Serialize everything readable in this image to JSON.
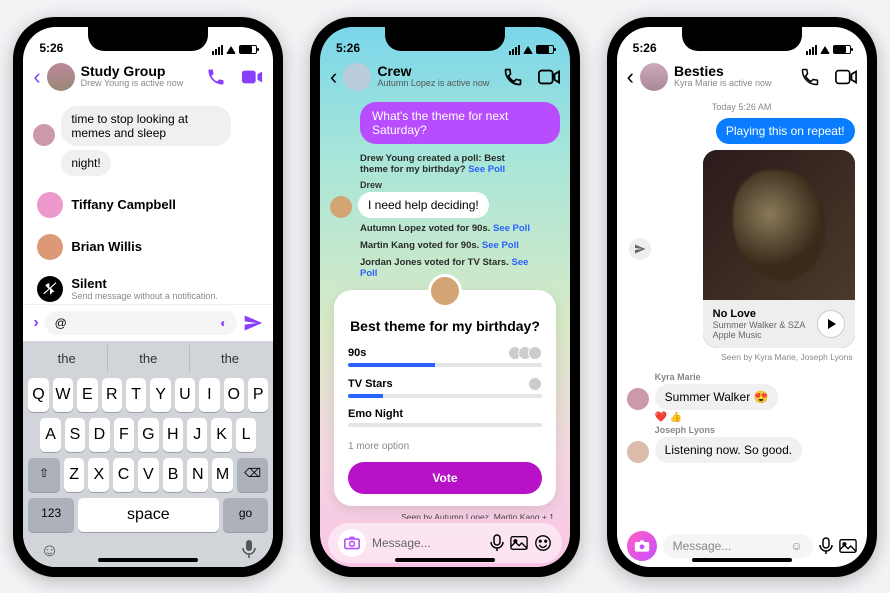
{
  "status": {
    "time": "5:26"
  },
  "phone1": {
    "header": {
      "title": "Study Group",
      "subtitle": "Drew Young is active now"
    },
    "messages": [
      {
        "text": "time to stop looking at memes and sleep"
      },
      {
        "text": "night!"
      }
    ],
    "mentions": [
      {
        "name": "Tiffany Campbell"
      },
      {
        "name": "Brian Willis"
      },
      {
        "name": "Silent",
        "desc": "Send message without a notification."
      }
    ],
    "compose": {
      "value": "@"
    },
    "suggestions": [
      "the",
      "the",
      "the"
    ],
    "keyboard": {
      "row1": [
        "Q",
        "W",
        "E",
        "R",
        "T",
        "Y",
        "U",
        "I",
        "O",
        "P"
      ],
      "row2": [
        "A",
        "S",
        "D",
        "F",
        "G",
        "H",
        "J",
        "K",
        "L"
      ],
      "row3": [
        "Z",
        "X",
        "C",
        "V",
        "B",
        "N",
        "M"
      ],
      "num": "123",
      "space": "space",
      "go": "go"
    }
  },
  "phone2": {
    "header": {
      "title": "Crew",
      "subtitle": "Autumn Lopez is active now"
    },
    "question": "What's the theme for next Saturday?",
    "events": [
      {
        "text": "Drew Young created a poll: Best theme for my birthday? ",
        "link": "See Poll"
      }
    ],
    "sender": "Drew",
    "msg": "I need help deciding!",
    "votes": [
      {
        "text": "Autumn Lopez voted for 90s. ",
        "link": "See Poll"
      },
      {
        "text": "Martin Kang voted for 90s. ",
        "link": "See Poll"
      },
      {
        "text": "Jordan Jones voted for TV Stars. ",
        "link": "See Poll"
      }
    ],
    "poll": {
      "title": "Best theme for my birthday?",
      "options": [
        {
          "label": "90s",
          "pct": 45,
          "voters": 3
        },
        {
          "label": "TV Stars",
          "pct": 18,
          "voters": 1
        },
        {
          "label": "Emo Night",
          "pct": 0,
          "voters": 0
        }
      ],
      "more": "1 more option",
      "vote": "Vote"
    },
    "seen": "Seen by Autumn Lopez, Martin Kang + 1",
    "compose": {
      "placeholder": "Message..."
    }
  },
  "phone3": {
    "header": {
      "title": "Besties",
      "subtitle": "Kyra Marie is active now"
    },
    "timestamp": "Today 5:26 AM",
    "me": "Playing this on repeat!",
    "music": {
      "title": "No Love",
      "artist": "Summer Walker & SZA",
      "source": "Apple Music"
    },
    "seen": "Seen by Kyra Marie, Joseph Lyons",
    "replies": [
      {
        "name": "Kyra Marie",
        "text": "Summer Walker 😍",
        "reactions": "❤️ 👍"
      },
      {
        "name": "Joseph Lyons",
        "text": "Listening now. So good."
      }
    ],
    "compose": {
      "placeholder": "Message..."
    }
  }
}
